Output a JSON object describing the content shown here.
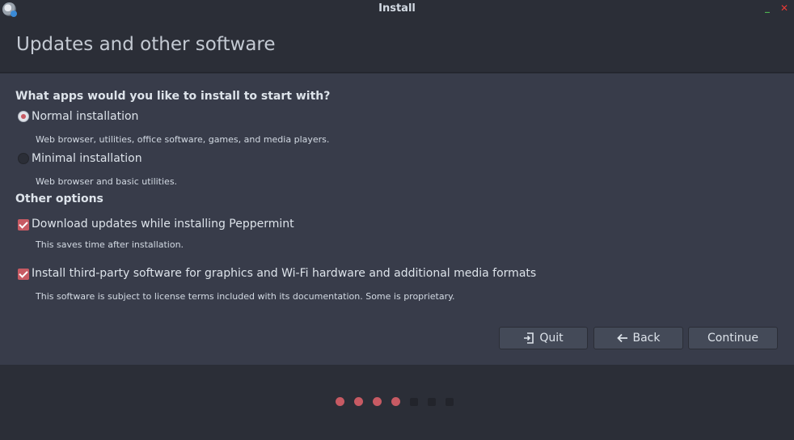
{
  "window": {
    "title": "Install",
    "minimize_glyph": "_",
    "close_glyph": "✕",
    "icon": "installer-disc-icon"
  },
  "page": {
    "title": "Updates and other software"
  },
  "apps_question": {
    "heading": "What apps would you like to install to start with?",
    "options": [
      {
        "label": "Normal installation",
        "description": "Web browser, utilities, office software, games, and media players.",
        "selected": true
      },
      {
        "label": "Minimal installation",
        "description": "Web browser and basic utilities.",
        "selected": false
      }
    ]
  },
  "other_options": {
    "heading": "Other options",
    "items": [
      {
        "label": "Download updates while installing Peppermint",
        "description": "This saves time after installation.",
        "checked": true
      },
      {
        "label": "Install third-party software for graphics and Wi-Fi hardware and additional media formats",
        "description": "This software is subject to license terms included with its documentation. Some is proprietary.",
        "checked": true
      }
    ]
  },
  "buttons": {
    "quit": {
      "label": "Quit",
      "icon": "exit-icon"
    },
    "back": {
      "label": "Back",
      "icon": "arrow-left-icon"
    },
    "continue": {
      "label": "Continue"
    }
  },
  "progress": {
    "steps_total": 7,
    "steps_done": 4,
    "done_color": "#c75a63",
    "todo_color": "#22242b"
  },
  "colors": {
    "accent": "#c75a63",
    "window_bg": "#2b2e37",
    "content_bg": "#383c4a",
    "button_bg": "#444a58"
  }
}
